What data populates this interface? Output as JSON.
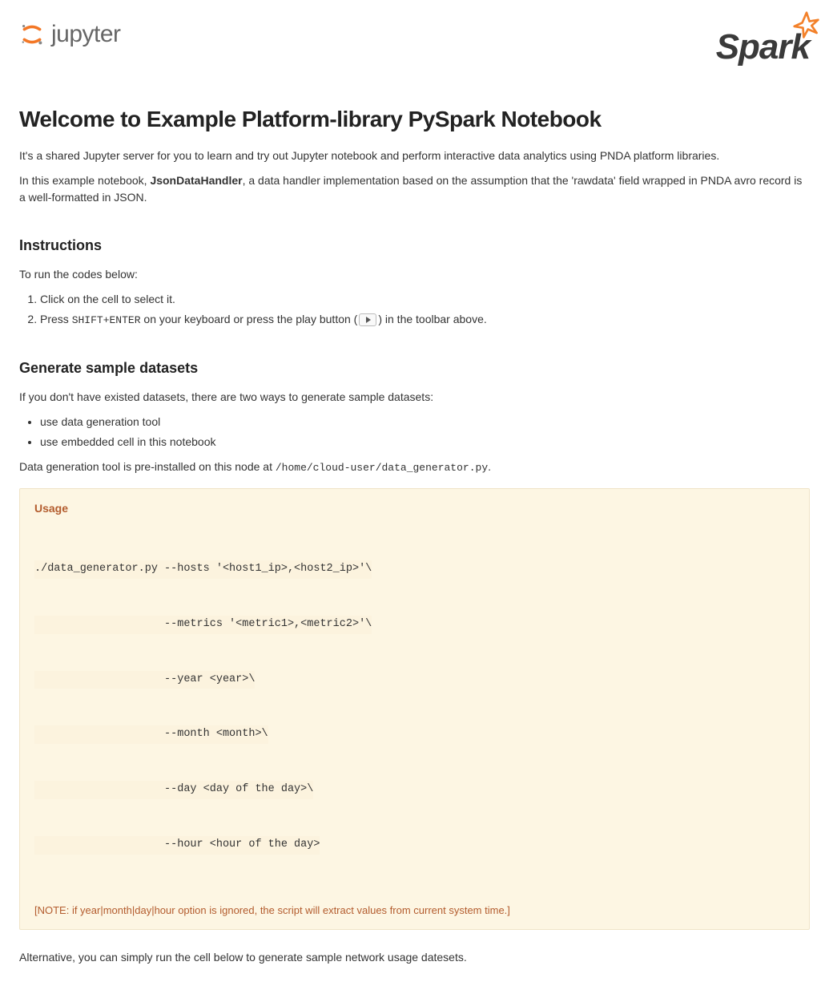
{
  "header": {
    "jupyter_text": "jupyter",
    "spark_text": "Spark"
  },
  "content": {
    "title": "Welcome to Example Platform-library PySpark Notebook",
    "intro1_pre": "It's a shared Jupyter server for you to learn and try out Jupyter notebook and perform interactive data analytics using PNDA platform libraries.",
    "intro2_pre": "In this example notebook, ",
    "intro2_strong": "JsonDataHandler",
    "intro2_post": ", a data handler implementation based on the assumption that the 'rawdata' field wrapped in PNDA avro record is a well-formatted in JSON.",
    "instructions_heading": "Instructions",
    "instructions_lead": "To run the codes below:",
    "instructions": {
      "step1": "Click on the cell to select it.",
      "step2_pre": "Press ",
      "step2_code": "SHIFT+ENTER",
      "step2_mid": " on your keyboard or press the play button (",
      "step2_post": ") in the toolbar above."
    },
    "generate_heading": "Generate sample datasets",
    "generate_lead": "If you don't have existed datasets, there are two ways to generate sample datasets:",
    "generate_items": {
      "item1": "use data generation tool",
      "item2": "use embedded cell in this notebook"
    },
    "tool_location_pre": "Data generation tool is pre-installed on this node at ",
    "tool_location_code": "/home/cloud-user/data_generator.py",
    "tool_location_post": ".",
    "usage": {
      "title": "Usage",
      "line1": "./data_generator.py --hosts '<host1_ip>,<host2_ip>'\\",
      "line2": "                    --metrics '<metric1>,<metric2>'\\",
      "line3": "                    --year <year>\\",
      "line4": "                    --month <month>\\",
      "line5": "                    --day <day of the day>\\",
      "line6": "                    --hour <hour of the day>",
      "note": "[NOTE: if year|month|day|hour option is ignored, the script will extract values from current system time.]"
    },
    "alternative_text": "Alternative, you can simply run the cell below to generate sample network usage datesets."
  }
}
